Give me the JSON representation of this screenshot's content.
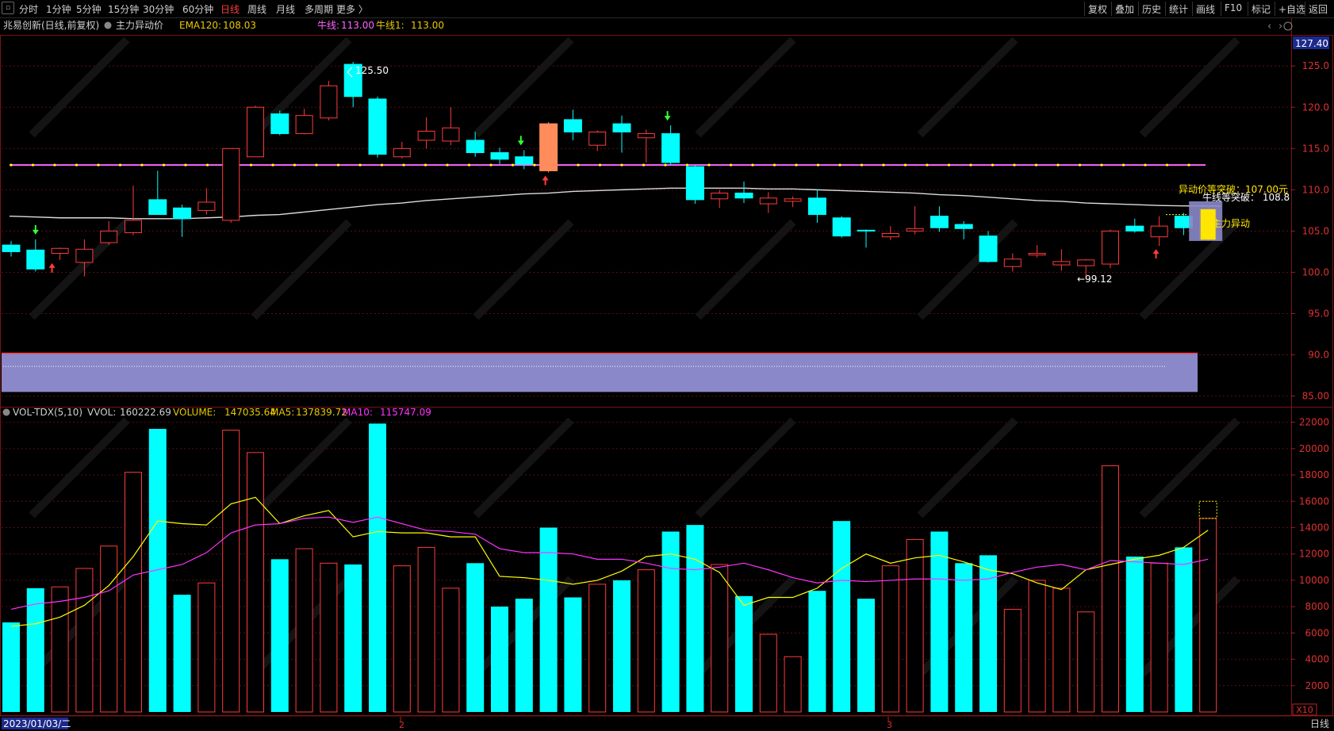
{
  "toolbar": {
    "periods": [
      "分时",
      "1分钟",
      "5分钟",
      "15分钟",
      "30分钟",
      "60分钟",
      "日线",
      "周线",
      "月线",
      "多周期",
      "更多 〉"
    ],
    "active_period": "日线",
    "right_items": [
      "复权",
      "叠加",
      "历史",
      "统计",
      "画线",
      "F10",
      "标记",
      "+自选",
      "返回"
    ]
  },
  "colors": {
    "up": "#ff3b3b",
    "down": "#00ffff",
    "ema120": "#dcdcdc",
    "bull_line": "#ff66ff",
    "bull_dots": "#ffff00",
    "ma5": "#ffff00",
    "ma10": "#ff33ff",
    "highlight_candle": "#ff8c5a",
    "signal_box": "#8a88c8",
    "signal_fill": "#ffe600"
  },
  "chart_data": [
    {
      "type": "candlestick",
      "title": "兆易创新(日线,前复权)",
      "indicator_name": "主力异动价",
      "indicators": [
        {
          "label": "EMA120:",
          "value": "108.03"
        },
        {
          "label": "牛线:",
          "value": "113.00"
        },
        {
          "label": "牛线1:",
          "value": "113.00"
        }
      ],
      "top_price_label": "127.40",
      "yticks": [
        "125.0",
        "120.0",
        "115.0",
        "110.0",
        "105.0",
        "100.0",
        "95.0",
        "90.0",
        "85.00"
      ],
      "ylim": [
        84,
        128
      ],
      "max_label": "125.50",
      "min_label": "←99.12",
      "bull_line_value": 113.0,
      "annotations": [
        "异动价等突破：107.00元",
        "牛线等突破：  108.8",
        "主力异动"
      ],
      "ohlc": [
        {
          "o": 103.3,
          "h": 103.8,
          "l": 101.9,
          "c": 102.5
        },
        {
          "o": 102.7,
          "h": 104.0,
          "l": 100.1,
          "c": 100.4
        },
        {
          "o": 102.3,
          "h": 103.0,
          "l": 101.5,
          "c": 102.9
        },
        {
          "o": 101.2,
          "h": 104.0,
          "l": 99.5,
          "c": 102.8
        },
        {
          "o": 103.6,
          "h": 106.2,
          "l": 103.3,
          "c": 105.0
        },
        {
          "o": 104.8,
          "h": 110.5,
          "l": 104.5,
          "c": 106.3
        },
        {
          "o": 108.8,
          "h": 112.3,
          "l": 107.0,
          "c": 107.0
        },
        {
          "o": 107.8,
          "h": 108.2,
          "l": 104.3,
          "c": 106.5
        },
        {
          "o": 107.5,
          "h": 110.2,
          "l": 107.0,
          "c": 108.5
        },
        {
          "o": 106.3,
          "h": 115.0,
          "l": 106.0,
          "c": 115.0
        },
        {
          "o": 114.0,
          "h": 120.2,
          "l": 114.0,
          "c": 120.0
        },
        {
          "o": 119.2,
          "h": 119.6,
          "l": 116.6,
          "c": 116.8
        },
        {
          "o": 116.8,
          "h": 119.8,
          "l": 116.7,
          "c": 119.0
        },
        {
          "o": 118.7,
          "h": 123.2,
          "l": 118.4,
          "c": 122.6
        },
        {
          "o": 125.2,
          "h": 125.5,
          "l": 120.0,
          "c": 121.3
        },
        {
          "o": 121.0,
          "h": 121.3,
          "l": 113.9,
          "c": 114.3
        },
        {
          "o": 114.0,
          "h": 115.8,
          "l": 113.8,
          "c": 115.0
        },
        {
          "o": 116.0,
          "h": 118.8,
          "l": 115.0,
          "c": 117.1
        },
        {
          "o": 115.9,
          "h": 120.0,
          "l": 115.4,
          "c": 117.5
        },
        {
          "o": 116.0,
          "h": 117.0,
          "l": 114.0,
          "c": 114.5
        },
        {
          "o": 114.5,
          "h": 115.1,
          "l": 113.1,
          "c": 113.7
        },
        {
          "o": 114.0,
          "h": 114.8,
          "l": 112.5,
          "c": 113.1
        },
        {
          "o": 112.3,
          "h": 118.2,
          "l": 112.1,
          "c": 118.0
        },
        {
          "o": 118.5,
          "h": 119.7,
          "l": 116.0,
          "c": 117.0
        },
        {
          "o": 115.4,
          "h": 117.2,
          "l": 114.7,
          "c": 117.0
        },
        {
          "o": 118.0,
          "h": 119.0,
          "l": 114.5,
          "c": 117.0
        },
        {
          "o": 116.3,
          "h": 117.3,
          "l": 113.3,
          "c": 116.8
        },
        {
          "o": 116.8,
          "h": 117.8,
          "l": 113.0,
          "c": 113.3
        },
        {
          "o": 112.8,
          "h": 113.0,
          "l": 108.3,
          "c": 108.8
        },
        {
          "o": 108.9,
          "h": 110.0,
          "l": 107.8,
          "c": 109.6
        },
        {
          "o": 109.6,
          "h": 111.0,
          "l": 108.4,
          "c": 109.0
        },
        {
          "o": 108.3,
          "h": 109.7,
          "l": 107.2,
          "c": 109.0
        },
        {
          "o": 108.6,
          "h": 109.2,
          "l": 107.9,
          "c": 108.9
        },
        {
          "o": 109.0,
          "h": 110.0,
          "l": 106.0,
          "c": 107.0
        },
        {
          "o": 106.6,
          "h": 106.8,
          "l": 104.2,
          "c": 104.4
        },
        {
          "o": 105.1,
          "h": 105.2,
          "l": 103.0,
          "c": 105.0
        },
        {
          "o": 104.3,
          "h": 105.6,
          "l": 103.9,
          "c": 104.7
        },
        {
          "o": 105.0,
          "h": 108.0,
          "l": 104.6,
          "c": 105.3
        },
        {
          "o": 106.8,
          "h": 108.0,
          "l": 104.9,
          "c": 105.4
        },
        {
          "o": 105.8,
          "h": 106.2,
          "l": 104.0,
          "c": 105.3
        },
        {
          "o": 104.4,
          "h": 105.0,
          "l": 101.2,
          "c": 101.3
        },
        {
          "o": 100.7,
          "h": 102.3,
          "l": 100.1,
          "c": 101.6
        },
        {
          "o": 102.1,
          "h": 103.3,
          "l": 101.8,
          "c": 102.3
        },
        {
          "o": 100.9,
          "h": 102.8,
          "l": 100.2,
          "c": 101.3
        },
        {
          "o": 100.8,
          "h": 101.6,
          "l": 99.1,
          "c": 101.5
        },
        {
          "o": 101.0,
          "h": 105.2,
          "l": 100.5,
          "c": 105.0
        },
        {
          "o": 105.6,
          "h": 106.5,
          "l": 104.8,
          "c": 105.0
        },
        {
          "o": 104.3,
          "h": 106.8,
          "l": 103.2,
          "c": 105.6
        },
        {
          "o": 106.8,
          "h": 107.2,
          "l": 104.5,
          "c": 105.4
        },
        {
          "o": 104.0,
          "h": 108.0,
          "l": 103.8,
          "c": 107.6
        }
      ],
      "ema120": [
        106.8,
        106.7,
        106.6,
        106.6,
        106.6,
        106.5,
        106.5,
        106.5,
        106.6,
        106.7,
        106.9,
        107.0,
        107.3,
        107.6,
        107.9,
        108.2,
        108.4,
        108.7,
        108.9,
        109.1,
        109.3,
        109.5,
        109.6,
        109.8,
        109.9,
        110.0,
        110.1,
        110.2,
        110.2,
        110.2,
        110.2,
        110.1,
        110.1,
        110.0,
        109.9,
        109.8,
        109.7,
        109.6,
        109.4,
        109.3,
        109.1,
        108.9,
        108.7,
        108.6,
        108.4,
        108.3,
        108.2,
        108.1,
        108.05,
        108.03
      ],
      "up_arrows": [
        2,
        22,
        47
      ],
      "down_arrows": [
        1,
        21,
        27
      ],
      "highlight_candle_index": 22
    },
    {
      "type": "bar",
      "title": "VOL-TDX(5,10)",
      "indicators": [
        {
          "label": "VVOL:",
          "value": "160222.69"
        },
        {
          "label": "VOLUME:",
          "value": "147035.64"
        },
        {
          "label": "MA5:",
          "value": "137839.72"
        },
        {
          "label": "MA10:",
          "value": "115747.09"
        }
      ],
      "unit_label": "X10",
      "yticks": [
        2000,
        4000,
        6000,
        8000,
        10000,
        12000,
        14000,
        16000,
        18000,
        20000,
        22000
      ],
      "ylim": [
        0,
        23000
      ],
      "volume": [
        6800,
        9400,
        9500,
        10900,
        12600,
        18200,
        21500,
        8900,
        9800,
        21400,
        19700,
        11600,
        12400,
        11300,
        11200,
        21900,
        11100,
        12500,
        9400,
        11300,
        8000,
        8600,
        14000,
        8700,
        9700,
        10000,
        10800,
        13700,
        14200,
        11200,
        8800,
        5900,
        4200,
        9200,
        14500,
        8600,
        11100,
        13100,
        13700,
        11300,
        11900,
        7800,
        10000,
        9400,
        7600,
        18700,
        11800,
        11300,
        12500,
        14700
      ],
      "ma5": [
        6500,
        6700,
        7200,
        8100,
        9600,
        11800,
        14500,
        14300,
        14200,
        15800,
        16300,
        14300,
        14900,
        15300,
        13300,
        13700,
        13600,
        13600,
        13300,
        13300,
        10300,
        10200,
        10000,
        9700,
        10000,
        10700,
        11800,
        12000,
        11600,
        10600,
        8100,
        8700,
        8700,
        9400,
        10900,
        12000,
        11300,
        11700,
        11900,
        11400,
        10800,
        10500,
        9800,
        9300,
        10800,
        11200,
        11600,
        11900,
        12500,
        13800
      ],
      "ma10": [
        7800,
        8200,
        8400,
        8700,
        9200,
        10400,
        10800,
        11200,
        12100,
        13600,
        14200,
        14300,
        14700,
        14800,
        14400,
        14800,
        14300,
        13800,
        13700,
        13500,
        12400,
        12100,
        12100,
        12000,
        11600,
        11600,
        11300,
        10900,
        10800,
        11000,
        11300,
        10800,
        10200,
        9800,
        10000,
        9900,
        10000,
        10100,
        10100,
        10000,
        10100,
        10600,
        11000,
        11200,
        10800,
        11500,
        11400,
        11300,
        11200,
        11600
      ],
      "x_labels": [
        "2023/01/03/二",
        "2",
        "3",
        "日线"
      ]
    }
  ]
}
